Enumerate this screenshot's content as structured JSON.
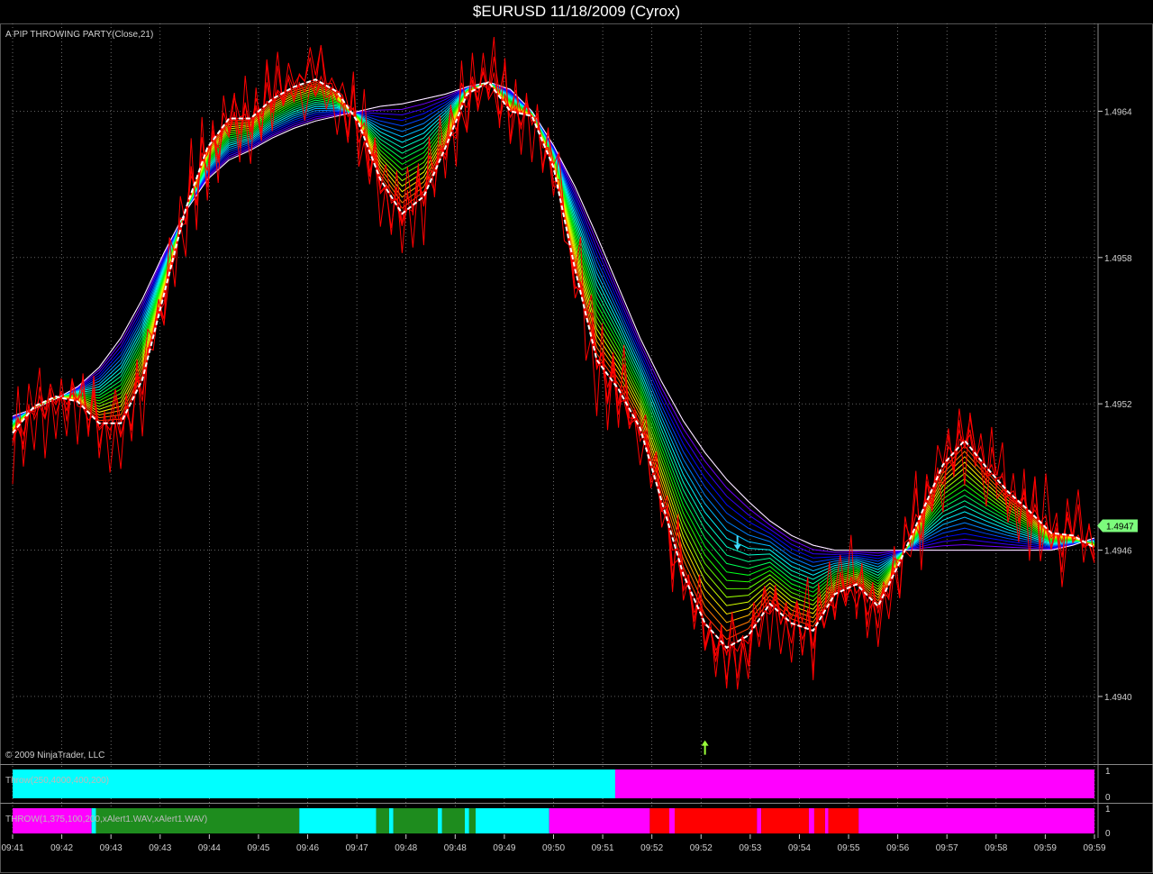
{
  "window": {
    "title": "$EURUSD  11/18/2009 (Cyrox)"
  },
  "panels": {
    "main_label": "A PIP THROWING PARTY(Close,21)",
    "copyright": "© 2009 NinjaTrader, LLC",
    "throw1_label": "Throw(250,4000,400,200)",
    "throw2_label": "THROW(1,375,100,200,xAlert1.WAV,xAlert1.WAV)",
    "throw1_ticks": [
      "1",
      "0"
    ],
    "throw2_ticks": [
      "1",
      "0"
    ]
  },
  "colors": {
    "background": "#000000",
    "grid": "#9a9a9a",
    "price": "#ff0000",
    "dashed_avg": "#ffffff",
    "last_price_badge": "#7cfc7c",
    "cyan": "#00ffff",
    "magenta": "#ff00ff",
    "green": "#1e8c1e",
    "red": "#ff0000",
    "up_arrow": "#9aff3a",
    "down_arrow": "#44ddff"
  },
  "chart_data": {
    "type": "line",
    "title": "$EURUSD  11/18/2009 (Cyrox)",
    "xlabel": "",
    "ylabel": "",
    "grid": true,
    "ylim": [
      1.49373,
      1.49676
    ],
    "y_ticks": [
      "1.4964",
      "1.4958",
      "1.4952",
      "1.4946",
      "1.4940"
    ],
    "last_price": "1.4947",
    "x_tick_labels": [
      "09:41",
      "09:42",
      "09:43",
      "09:43",
      "09:44",
      "09:45",
      "09:46",
      "09:47",
      "09:48",
      "09:48",
      "09:49",
      "09:50",
      "09:51",
      "09:52",
      "09:52",
      "09:53",
      "09:54",
      "09:55",
      "09:56",
      "09:57",
      "09:58",
      "09:59",
      "09:59"
    ],
    "series": [
      {
        "role": "smoothed_average",
        "values": [
          1.49508,
          1.49519,
          1.49523,
          1.49521,
          1.49512,
          1.49512,
          1.4953,
          1.49565,
          1.496,
          1.49625,
          1.49637,
          1.49637,
          1.49645,
          1.4965,
          1.49653,
          1.49648,
          1.49635,
          1.49612,
          1.49598,
          1.49605,
          1.49625,
          1.49647,
          1.49652,
          1.4964,
          1.49638,
          1.49617,
          1.49575,
          1.49538,
          1.49526,
          1.4951,
          1.4948,
          1.4945,
          1.4943,
          1.4942,
          1.49425,
          1.49438,
          1.4943,
          1.49427,
          1.49442,
          1.49446,
          1.49437,
          1.49455,
          1.49475,
          1.49495,
          1.49505,
          1.49494,
          1.49484,
          1.49476,
          1.49467,
          1.49466,
          1.49461
        ]
      },
      {
        "role": "slow_average",
        "values": [
          1.49515,
          1.49518,
          1.49522,
          1.49527,
          1.49535,
          1.49547,
          1.49563,
          1.49582,
          1.49599,
          1.49612,
          1.4962,
          1.49624,
          1.49629,
          1.49633,
          1.49636,
          1.49638,
          1.4964,
          1.49642,
          1.49643,
          1.49645,
          1.49647,
          1.4965,
          1.49652,
          1.49649,
          1.4964,
          1.49626,
          1.49609,
          1.49589,
          1.49568,
          1.49547,
          1.49529,
          1.49513,
          1.495,
          1.49489,
          1.4948,
          1.49472,
          1.49466,
          1.49462,
          1.4946,
          1.4946,
          1.4946,
          1.4946,
          1.4946,
          1.4946,
          1.4946,
          1.4946,
          1.4946,
          1.4946,
          1.4946,
          1.49462,
          1.49465
        ]
      }
    ],
    "ribbon_lines": 21,
    "signals": [
      {
        "type": "up",
        "x_index": 32,
        "price": 1.49382
      },
      {
        "type": "down",
        "x_index": 33.5,
        "price": 1.4946
      }
    ],
    "throw1_segments": [
      {
        "start": 0,
        "end": 0.557,
        "state": "cyan"
      },
      {
        "start": 0.557,
        "end": 1,
        "state": "magenta"
      }
    ],
    "throw2_segments": [
      {
        "start": 0,
        "end": 0.073,
        "state": "magenta"
      },
      {
        "start": 0.073,
        "end": 0.077,
        "state": "cyan"
      },
      {
        "start": 0.077,
        "end": 0.265,
        "state": "green"
      },
      {
        "start": 0.265,
        "end": 0.336,
        "state": "cyan"
      },
      {
        "start": 0.336,
        "end": 0.348,
        "state": "green"
      },
      {
        "start": 0.348,
        "end": 0.352,
        "state": "cyan"
      },
      {
        "start": 0.352,
        "end": 0.393,
        "state": "green"
      },
      {
        "start": 0.393,
        "end": 0.397,
        "state": "cyan"
      },
      {
        "start": 0.397,
        "end": 0.418,
        "state": "green"
      },
      {
        "start": 0.418,
        "end": 0.422,
        "state": "cyan"
      },
      {
        "start": 0.422,
        "end": 0.428,
        "state": "green"
      },
      {
        "start": 0.428,
        "end": 0.496,
        "state": "cyan"
      },
      {
        "start": 0.496,
        "end": 0.589,
        "state": "magenta"
      },
      {
        "start": 0.589,
        "end": 0.607,
        "state": "red"
      },
      {
        "start": 0.607,
        "end": 0.612,
        "state": "magenta"
      },
      {
        "start": 0.612,
        "end": 0.688,
        "state": "red"
      },
      {
        "start": 0.688,
        "end": 0.692,
        "state": "magenta"
      },
      {
        "start": 0.692,
        "end": 0.736,
        "state": "red"
      },
      {
        "start": 0.736,
        "end": 0.741,
        "state": "magenta"
      },
      {
        "start": 0.741,
        "end": 0.751,
        "state": "red"
      },
      {
        "start": 0.751,
        "end": 0.754,
        "state": "magenta"
      },
      {
        "start": 0.754,
        "end": 0.782,
        "state": "red"
      },
      {
        "start": 0.782,
        "end": 1,
        "state": "magenta"
      }
    ]
  }
}
